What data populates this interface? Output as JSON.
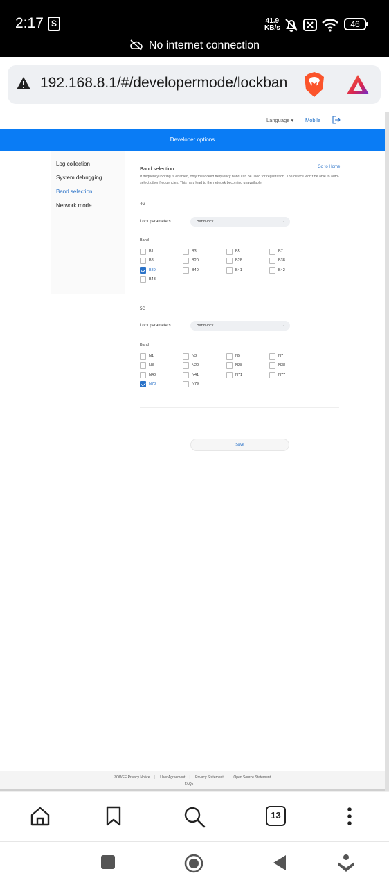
{
  "status_bar": {
    "time": "2:17",
    "shop_icon_letter": "S",
    "net_speed_value": "41.9",
    "net_speed_unit": "KB/s",
    "battery": "46",
    "offline_text": "No internet connection"
  },
  "browser": {
    "url": "192.168.8.1/#/developermode/lockban",
    "tab_count": "13"
  },
  "topnav": {
    "language": "Language ▾",
    "mobile": "Mobile"
  },
  "banner_title": "Developer options",
  "sidebar": {
    "items": [
      {
        "label": "Log collection"
      },
      {
        "label": "System debugging"
      },
      {
        "label": "Band selection"
      },
      {
        "label": "Network mode"
      }
    ]
  },
  "content": {
    "title": "Band selection",
    "go_home": "Go to Home",
    "description": "If frequency locking is enabled, only the locked frequency band can be used for registration. The device won't be able to auto-select other frequencies. This may lead to the network becoming unavailable.",
    "lte": {
      "heading": "4G",
      "lock_label": "Lock parameters",
      "lock_value": "Band-lock",
      "band_label": "Band",
      "bands": [
        {
          "name": "B1",
          "checked": false
        },
        {
          "name": "B3",
          "checked": false
        },
        {
          "name": "B5",
          "checked": false
        },
        {
          "name": "B7",
          "checked": false
        },
        {
          "name": "B8",
          "checked": false
        },
        {
          "name": "B20",
          "checked": false
        },
        {
          "name": "B28",
          "checked": false
        },
        {
          "name": "B38",
          "checked": false
        },
        {
          "name": "B39",
          "checked": true
        },
        {
          "name": "B40",
          "checked": false
        },
        {
          "name": "B41",
          "checked": false
        },
        {
          "name": "B42",
          "checked": false
        },
        {
          "name": "B43",
          "checked": false
        }
      ]
    },
    "nr": {
      "heading": "5G",
      "lock_label": "Lock parameters",
      "lock_value": "Band-lock",
      "band_label": "Band",
      "bands": [
        {
          "name": "N1",
          "checked": false
        },
        {
          "name": "N3",
          "checked": false
        },
        {
          "name": "N5",
          "checked": false
        },
        {
          "name": "N7",
          "checked": false
        },
        {
          "name": "N8",
          "checked": false
        },
        {
          "name": "N20",
          "checked": false
        },
        {
          "name": "N28",
          "checked": false
        },
        {
          "name": "N38",
          "checked": false
        },
        {
          "name": "N40",
          "checked": false
        },
        {
          "name": "N41",
          "checked": false
        },
        {
          "name": "N71",
          "checked": false
        },
        {
          "name": "N77",
          "checked": false
        },
        {
          "name": "N78",
          "checked": true
        },
        {
          "name": "N79",
          "checked": false
        }
      ]
    },
    "save": "Save"
  },
  "footer": {
    "links": [
      "ZOWEE Privacy Notice",
      "User Agreement",
      "Privacy Statement",
      "Open Source Statement"
    ],
    "faqs": "FAQs"
  },
  "colors": {
    "banner": "#0a7cf5",
    "accent": "#2a72c8"
  }
}
